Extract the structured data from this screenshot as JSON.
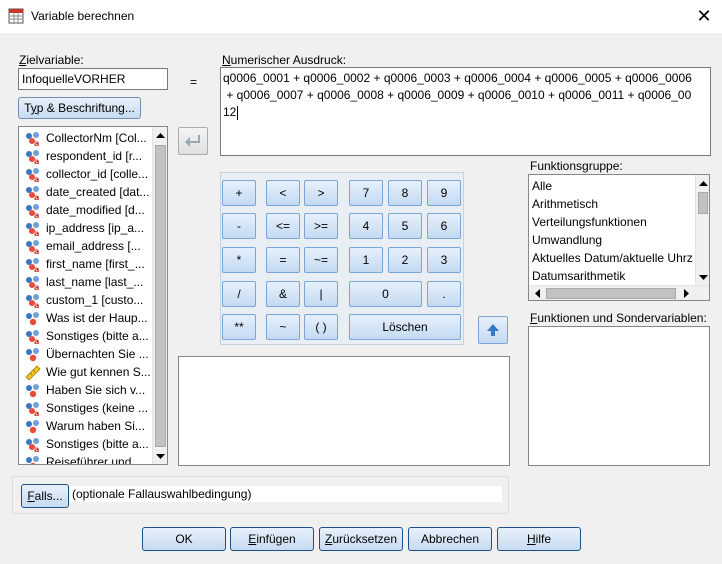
{
  "window": {
    "title": "Variable berechnen"
  },
  "target": {
    "label": "Zielvariable:",
    "value": "InfoquelleVORHER",
    "equals": "=",
    "type_button": "Typ & Beschriftung..."
  },
  "expression": {
    "label": "Numerischer Ausdruck:",
    "lines": [
      "q0006_0001 + q0006_0002 + q0006_0003 + q0006_0004 + q0006_0005 + q0006_0006",
      " + q0006_0007 + q0006_0008 + q0006_0009 + q0006_0010 + q0006_0011 + q0006_00",
      "12"
    ]
  },
  "variables": [
    {
      "label": "CollectorNm [Col...",
      "icon": "nominal-string-icon"
    },
    {
      "label": "respondent_id [r...",
      "icon": "nominal-string-icon"
    },
    {
      "label": "collector_id [colle...",
      "icon": "nominal-string-icon"
    },
    {
      "label": "date_created [dat...",
      "icon": "nominal-string-icon"
    },
    {
      "label": "date_modified [d...",
      "icon": "nominal-string-icon"
    },
    {
      "label": "ip_address [ip_a...",
      "icon": "nominal-string-icon"
    },
    {
      "label": "email_address [...",
      "icon": "nominal-string-icon"
    },
    {
      "label": "first_name [first_...",
      "icon": "nominal-string-icon"
    },
    {
      "label": "last_name [last_...",
      "icon": "nominal-string-icon"
    },
    {
      "label": "custom_1 [custo...",
      "icon": "nominal-string-icon"
    },
    {
      "label": "Was ist der Haup...",
      "icon": "nominal-icon"
    },
    {
      "label": "Sonstiges (bitte a...",
      "icon": "nominal-string-icon"
    },
    {
      "label": "Übernachten Sie ...",
      "icon": "nominal-icon"
    },
    {
      "label": "Wie gut kennen S...",
      "icon": "scale-ruler-icon"
    },
    {
      "label": "Haben Sie sich v...",
      "icon": "nominal-icon"
    },
    {
      "label": "Sonstiges (keine ...",
      "icon": "nominal-string-icon"
    },
    {
      "label": "Warum haben Si...",
      "icon": "nominal-icon"
    },
    {
      "label": "Sonstiges (bitte a...",
      "icon": "nominal-string-icon"
    },
    {
      "label": "Reiseführer und...",
      "icon": "nominal-icon"
    }
  ],
  "keypad": {
    "plus": "+",
    "lt": "<",
    "gt": ">",
    "k7": "7",
    "k8": "8",
    "k9": "9",
    "minus": "-",
    "le": "<=",
    "ge": ">=",
    "k4": "4",
    "k5": "5",
    "k6": "6",
    "times": "*",
    "eq": "=",
    "ne": "~=",
    "k1": "1",
    "k2": "2",
    "k3": "3",
    "div": "/",
    "and": "&",
    "or": "|",
    "k0": "0",
    "dot": ".",
    "pow": "**",
    "not": "~",
    "paren": "( )",
    "clear": "Löschen"
  },
  "functions": {
    "group_label": "Funktionsgruppe:",
    "groups": [
      "Alle",
      "Arithmetisch",
      "Verteilungsfunktionen",
      "Umwandlung",
      "Aktuelles Datum/aktuelle Uhrz",
      "Datumsarithmetik"
    ],
    "special_label": "Funktionen und Sondervariablen:"
  },
  "falls": {
    "button": "Falls...",
    "text": "(optionale Fallauswahlbedingung)"
  },
  "buttons": {
    "ok": "OK",
    "paste": "Einfügen",
    "reset": "Zurücksetzen",
    "cancel": "Abbrechen",
    "help": "Hilfe"
  }
}
